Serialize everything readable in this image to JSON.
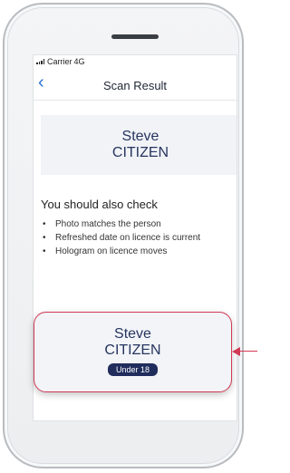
{
  "status_bar": {
    "carrier": "Carrier",
    "network": "4G"
  },
  "nav": {
    "back_icon": "chevron-left-icon",
    "title": "Scan Result"
  },
  "name_card": {
    "first_name": "Steve",
    "last_name": "CITIZEN"
  },
  "checks": {
    "heading": "You should also check",
    "items": [
      "Photo matches the person",
      "Refreshed date on licence is current",
      "Hologram on licence moves"
    ]
  },
  "result_card": {
    "first_name": "Steve",
    "last_name": "CITIZEN",
    "badge": "Under 18"
  },
  "colors": {
    "accent": "#d13a55",
    "navy": "#1f2c5c",
    "link": "#2b73d6"
  }
}
